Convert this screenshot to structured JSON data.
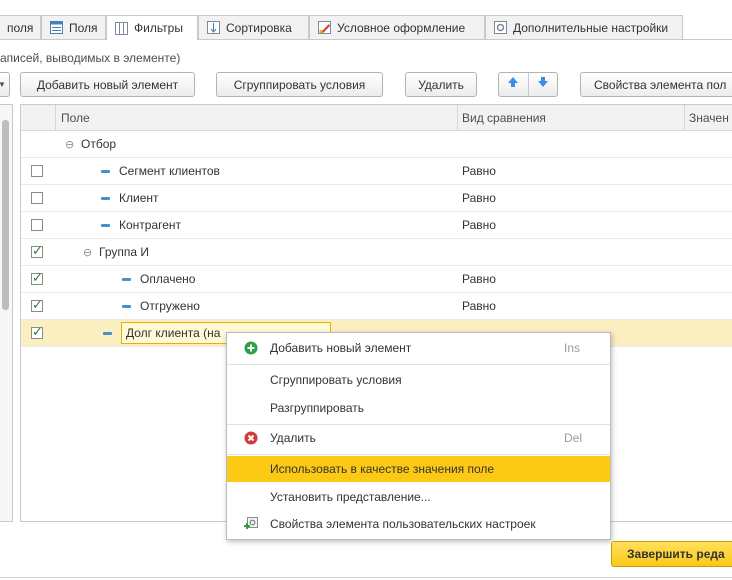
{
  "tabs": [
    {
      "label": "поля",
      "icon": "none"
    },
    {
      "label": "Поля",
      "icon": "fields-icon"
    },
    {
      "label": "Фильтры",
      "icon": "filter-icon",
      "active": true
    },
    {
      "label": "Сортировка",
      "icon": "sort-icon"
    },
    {
      "label": "Условное оформление",
      "icon": "conditional-format-icon"
    },
    {
      "label": "Дополнительные настройки",
      "icon": "settings-icon"
    }
  ],
  "hint": "аписей, выводимых в элементе)",
  "toolbar": {
    "add": "Добавить новый элемент",
    "group": "Сгруппировать условия",
    "delete": "Удалить",
    "props": "Свойства элемента пол"
  },
  "grid": {
    "col_field": "Поле",
    "col_compare": "Вид сравнения",
    "col_value": "Значен",
    "rows": [
      {
        "label": "Отбор",
        "type": "group-root",
        "checked": null,
        "compare": ""
      },
      {
        "label": "Сегмент клиентов",
        "type": "item",
        "checked": false,
        "compare": "Равно"
      },
      {
        "label": "Клиент",
        "type": "item",
        "checked": false,
        "compare": "Равно"
      },
      {
        "label": "Контрагент",
        "type": "item",
        "checked": false,
        "compare": "Равно"
      },
      {
        "label": "Группа И",
        "type": "group",
        "checked": true,
        "compare": ""
      },
      {
        "label": "Оплачено",
        "type": "subitem",
        "checked": true,
        "compare": "Равно"
      },
      {
        "label": "Отгружено",
        "type": "subitem",
        "checked": true,
        "compare": "Равно"
      },
      {
        "label": "Долг клиента (на",
        "type": "subitem-edit",
        "checked": true,
        "compare": ""
      }
    ]
  },
  "menu": {
    "add": "Добавить новый элемент",
    "add_shortcut": "Ins",
    "group": "Сгруппировать условия",
    "ungroup": "Разгруппировать",
    "delete": "Удалить",
    "delete_shortcut": "Del",
    "use_as_value": "Использовать в качестве значения поле",
    "set_presentation": "Установить представление...",
    "props": "Свойства элемента пользовательских настроек"
  },
  "finish_button": "Завершить реда",
  "colors": {
    "accent": "#fcc914",
    "selected_row": "#fbeec0",
    "check": "#2e7d32",
    "blue": "#4a90c8"
  }
}
